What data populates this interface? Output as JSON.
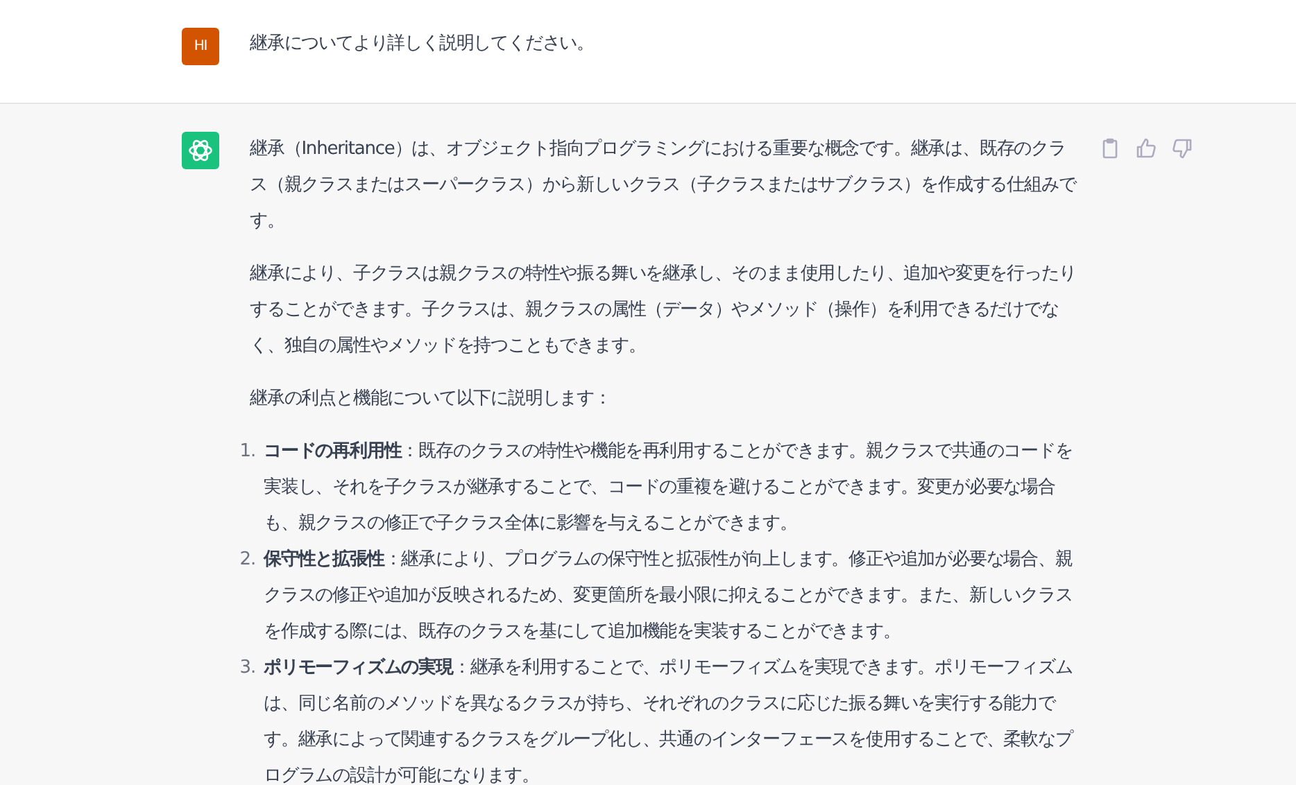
{
  "user_message": {
    "avatar": "HI",
    "text": "継承についてより詳しく説明してください。"
  },
  "assistant_message": {
    "paragraphs": [
      "継承（Inheritance）は、オブジェクト指向プログラミングにおける重要な概念です。継承は、既存のクラス（親クラスまたはスーパークラス）から新しいクラス（子クラスまたはサブクラス）を作成する仕組みです。",
      "継承により、子クラスは親クラスの特性や振る舞いを継承し、そのまま使用したり、追加や変更を行ったりすることができます。子クラスは、親クラスの属性（データ）やメソッド（操作）を利用できるだけでなく、独自の属性やメソッドを持つこともできます。",
      "継承の利点と機能について以下に説明します："
    ],
    "list": [
      {
        "number": "1.",
        "text": "**コードの再利用性**：既存のクラスの特性や機能を再利用することができます。親クラスで共通のコードを実装し、それを子クラスが継承することで、コードの重複を避けることができます。変更が必要な場合も、親クラスの修正で子クラス全体に影響を与えることができます。"
      },
      {
        "number": "2.",
        "text": "**保守性と拡張性**：継承により、プログラムの保守性と拡張性が向上します。修正や追加が必要な場合、親クラスの修正や追加が反映されるため、変更箇所を最小限に抑えることができます。また、新しいクラスを作成する際には、既存のクラスを基にして追加機能を実装することができます。"
      },
      {
        "number": "3.",
        "text": "**ポリモーフィズムの実現**：継承を利用することで、ポリモーフィズムを実現できます。ポリモーフィズムは、同じ名前のメソッドを異なるクラスが持ち、それぞれのクラスに応じた振る舞いを実行する能力です。継承によって関連するクラスをグループ化し、共通のインターフェースを使用することで、柔軟なプログラムの設計が可能になります。"
      }
    ]
  }
}
